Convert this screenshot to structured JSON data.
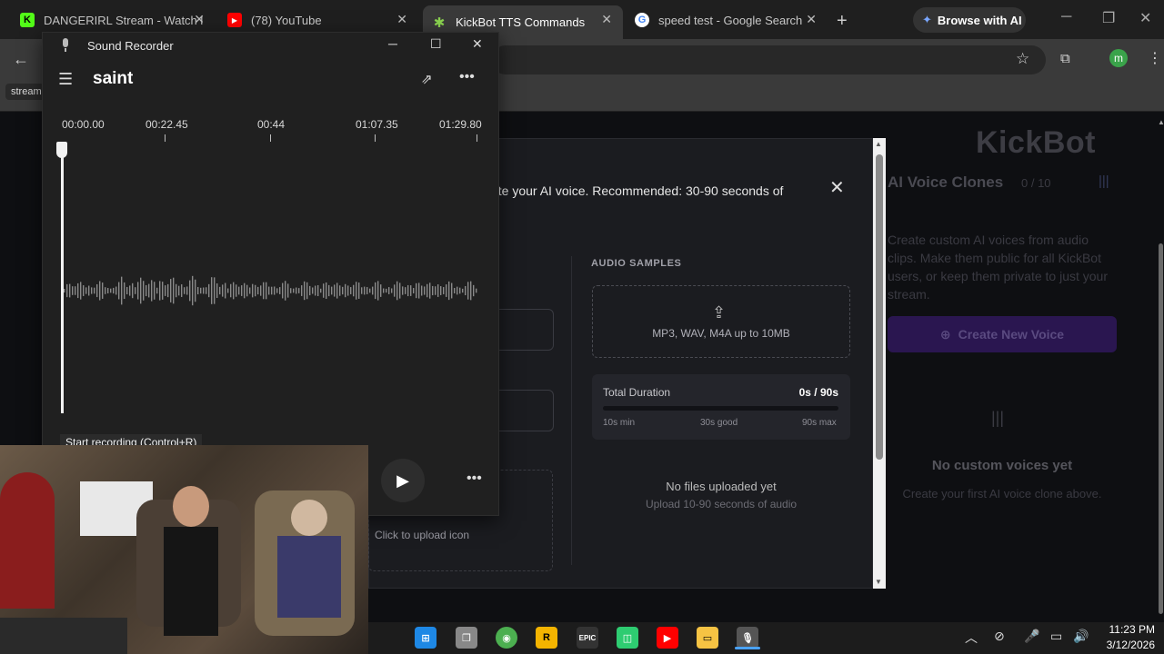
{
  "browser": {
    "tabs": [
      {
        "title": "DANGERIRL Stream - Watch l",
        "favicon": "kick-icon",
        "active": false
      },
      {
        "title": "(78) YouTube",
        "favicon": "youtube-icon",
        "active": false
      },
      {
        "title": "KickBot TTS Commands",
        "favicon": "kickbot-icon",
        "active": true
      },
      {
        "title": "speed test - Google Search",
        "favicon": "google-icon",
        "active": false
      }
    ],
    "new_tab": "+",
    "browse_ai": "Browse with AI",
    "bookmark_label": "stream",
    "profile_initial": "m"
  },
  "recorder": {
    "window_title": "Sound Recorder",
    "recording_name": "saint",
    "timeline": [
      "00:00.00",
      "00:22.45",
      "00:44",
      "01:07.35",
      "01:29.80"
    ],
    "tooltip": "Start recording (Control+R)"
  },
  "modal": {
    "instruction": "ate your AI voice. Recommended: 30-90 seconds of",
    "audio_samples_label": "AUDIO SAMPLES",
    "dropzone_text": "MP3, WAV, M4A up to 10MB",
    "total_duration_label": "Total Duration",
    "total_duration_value": "0s / 90s",
    "duration_progress": 0,
    "ticks": [
      "10s min",
      "30s good",
      "90s max"
    ],
    "no_files": "No files uploaded yet",
    "no_files_sub": "Upload 10-90 seconds of audio",
    "upload_icon_text": "Click to upload icon"
  },
  "kickbot": {
    "logo": "KickBot",
    "section_title": "AI Voice Clones",
    "count": "0 / 10",
    "description": "Create custom AI voices from audio clips. Make them public for all KickBot users, or keep them private to just your stream.",
    "create_button": "Create New Voice",
    "empty_title": "No custom voices yet",
    "empty_sub": "Create your first AI voice clone above."
  },
  "taskbar": {
    "time": "11:23 PM",
    "date": "3/12/2026"
  },
  "colors": {
    "accent": "#7b3fe4",
    "kick_green": "#53fc18",
    "youtube_red": "#ff0000"
  }
}
